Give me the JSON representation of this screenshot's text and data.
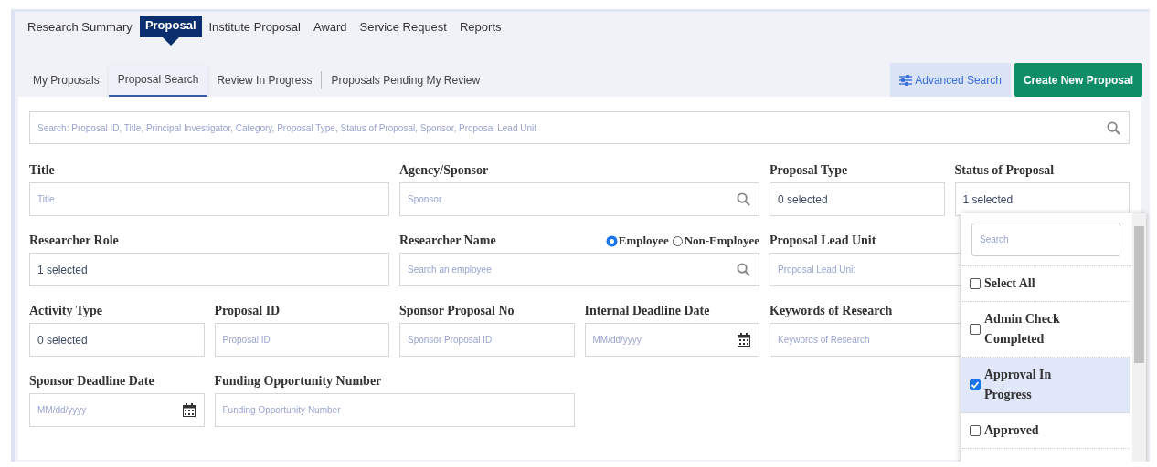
{
  "main_tabs": [
    {
      "label": "Research Summary",
      "selected": false
    },
    {
      "label": "Proposal",
      "selected": true
    },
    {
      "label": "Institute Proposal",
      "selected": false
    },
    {
      "label": "Award",
      "selected": false
    },
    {
      "label": "Service Request",
      "selected": false
    },
    {
      "label": "Reports",
      "selected": false
    }
  ],
  "sub_tabs": [
    {
      "label": "My Proposals",
      "selected": false
    },
    {
      "label": "Proposal Search",
      "selected": true
    },
    {
      "label": "Review In Progress",
      "selected": false
    },
    {
      "label": "Proposals Pending My Review",
      "selected": false
    }
  ],
  "advanced_search_button": "Advanced Search",
  "create_button": "Create New Proposal",
  "search": {
    "placeholder": "Search: Proposal ID, Title, Principal Investigator, Category, Proposal Type, Status of Proposal, Sponsor, Proposal Lead Unit"
  },
  "fields": [
    {
      "label": "Title",
      "kind": "text",
      "placeholder": "Title"
    },
    {
      "label": "Agency/Sponsor",
      "kind": "search",
      "placeholder": "Sponsor"
    },
    {
      "label": "Proposal Type",
      "kind": "select",
      "value": "0 selected"
    },
    {
      "label": "Status of Proposal",
      "kind": "select",
      "value": "1 selected"
    },
    {
      "label": "Researcher Role",
      "kind": "select",
      "value": "1 selected"
    },
    {
      "label": "Researcher Name",
      "kind": "search",
      "placeholder": "Search an employee",
      "options": [
        {
          "label": "Employee",
          "selected": true
        },
        {
          "label": "Non-Employee",
          "selected": false
        }
      ]
    },
    {
      "label": "Proposal Lead Unit",
      "kind": "text",
      "placeholder": "Proposal Lead Unit"
    },
    {
      "label": "Activity Type",
      "kind": "select",
      "value": "0 selected"
    },
    {
      "label": "Proposal ID",
      "kind": "text",
      "placeholder": "Proposal ID"
    },
    {
      "label": "Sponsor Proposal No",
      "kind": "text",
      "placeholder": "Sponsor Proposal ID"
    },
    {
      "label": "Internal Deadline Date",
      "kind": "date",
      "placeholder": "MM/dd/yyyy"
    },
    {
      "label": "Keywords of Research",
      "kind": "text",
      "placeholder": "Keywords of Research"
    },
    {
      "label": "Sponsor Deadline Date",
      "kind": "date",
      "placeholder": "MM/dd/yyyy"
    },
    {
      "label": "Funding Opportunity Number",
      "kind": "text",
      "placeholder": "Funding Opportunity Number"
    }
  ],
  "status_dropdown": {
    "search_placeholder": "Search",
    "items": [
      {
        "label": "Select All",
        "checked": false
      },
      {
        "label": "Admin Check Completed",
        "checked": false
      },
      {
        "label": "Approval In Progress",
        "checked": true
      },
      {
        "label": "Approved",
        "checked": false
      }
    ]
  }
}
